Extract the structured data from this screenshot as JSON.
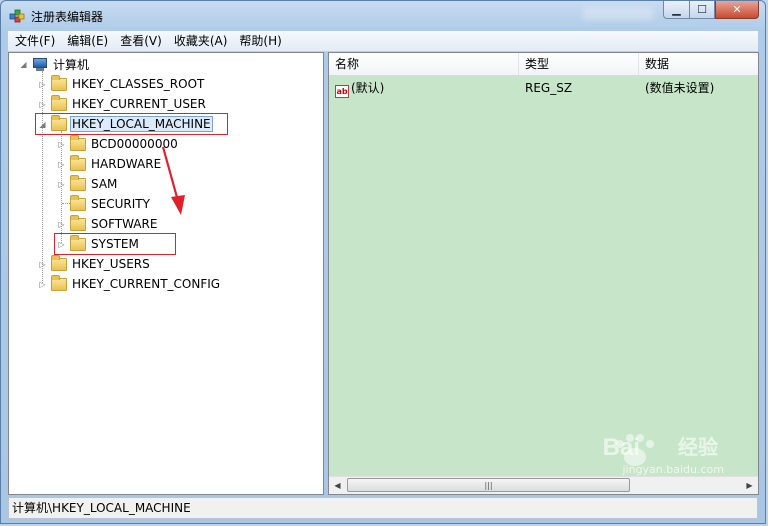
{
  "window": {
    "title": "注册表编辑器"
  },
  "menu": [
    "文件(F)",
    "编辑(E)",
    "查看(V)",
    "收藏夹(A)",
    "帮助(H)"
  ],
  "tree": {
    "root": "计算机",
    "hives": [
      {
        "label": "HKEY_CLASSES_ROOT"
      },
      {
        "label": "HKEY_CURRENT_USER"
      },
      {
        "label": "HKEY_LOCAL_MACHINE"
      },
      {
        "label": "HKEY_USERS"
      },
      {
        "label": "HKEY_CURRENT_CONFIG"
      }
    ],
    "hklm_children": [
      {
        "label": "BCD00000000"
      },
      {
        "label": "HARDWARE"
      },
      {
        "label": "SAM"
      },
      {
        "label": "SECURITY"
      },
      {
        "label": "SOFTWARE"
      },
      {
        "label": "SYSTEM"
      }
    ]
  },
  "list": {
    "columns": [
      "名称",
      "类型",
      "数据"
    ],
    "rows": [
      {
        "name": "(默认)",
        "type": "REG_SZ",
        "data": "(数值未设置)"
      }
    ]
  },
  "status": {
    "path": "计算机\\HKEY_LOCAL_MACHINE"
  },
  "watermark": {
    "brand": "Bai",
    "brand2": "经验",
    "url": "jingyan.baidu.com"
  },
  "colors": {
    "list_bg": "#c7e6c9",
    "annotation_red": "#e0202a"
  }
}
